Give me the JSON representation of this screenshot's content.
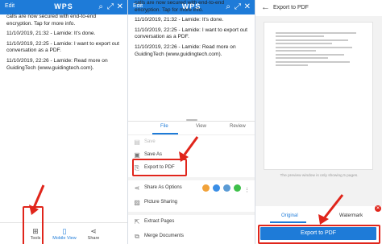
{
  "panel1": {
    "header": {
      "edit": "Edit",
      "app_name": "WPS"
    },
    "chat_lines": [
      "calls are now secured with end-to-end encryption. Tap for more info.",
      "11/10/2019, 21:32 - Lamide: It's done.",
      "11/10/2019, 22:25 - Lamide: I want to export out conversation as a PDF.",
      "11/10/2019, 22:26 - Lamide: Read more on GuidingTech (www.guidingtech.com)."
    ],
    "toolbar": {
      "tools": "Tools",
      "mobile_view": "Mobile View",
      "share": "Share"
    }
  },
  "panel2": {
    "header": {
      "edit": "Edit",
      "app_name": "WPS"
    },
    "chat_lines": [
      "calls are now secured with end-to-end encryption. Tap for more info.",
      "11/10/2019, 21:32 - Lamide: It's done.",
      "11/10/2019, 22:25 - Lamide: I want to export out conversation as a PDF.",
      "11/10/2019, 22:26 - Lamide: Read more on GuidingTech (www.guidingtech.com)."
    ],
    "tabs": [
      "File",
      "View",
      "Review"
    ],
    "menu": {
      "save": "Save",
      "save_as": "Save As",
      "export_pdf": "Export to PDF",
      "share_as_options": "Share As Options",
      "picture_sharing": "Picture Sharing",
      "extract_pages": "Extract Pages",
      "merge_documents": "Merge Documents"
    }
  },
  "panel3": {
    "title": "Export to PDF",
    "preview_note": "The preview window is only showing 5 pages.",
    "tab_original": "Original",
    "tab_watermark": "Watermark",
    "export_button": "Export to PDF"
  },
  "colors": {
    "accent": "#1e7bd8",
    "highlight": "#e0251b"
  }
}
